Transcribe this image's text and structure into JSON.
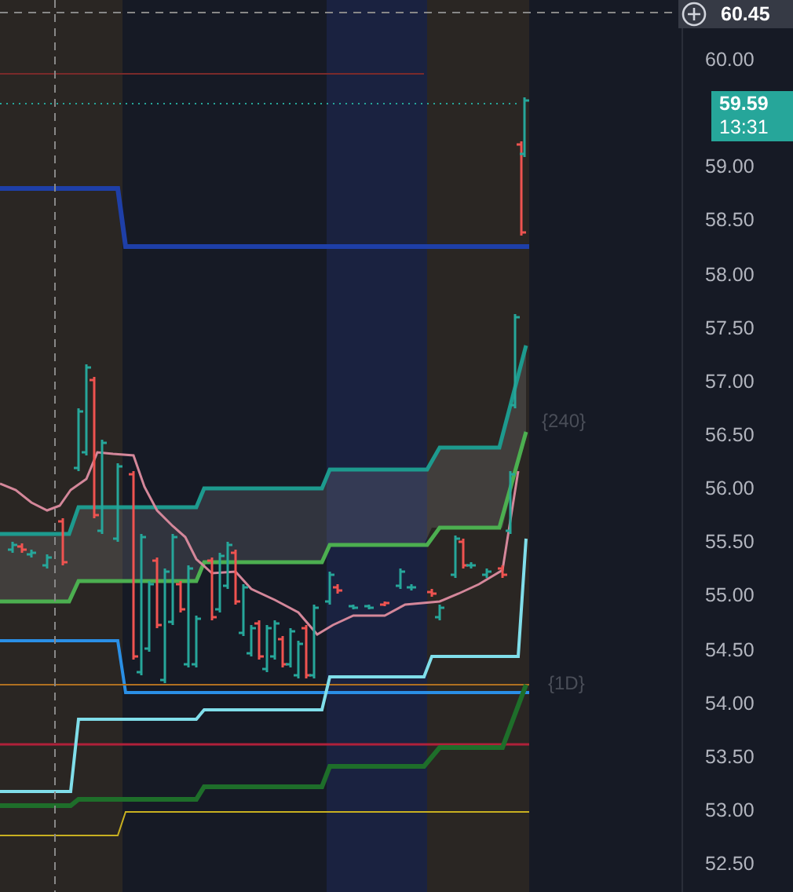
{
  "crosshair": {
    "price": "60.45"
  },
  "last_price": {
    "price": "59.59",
    "countdown": "13:31"
  },
  "price_axis": [
    "60.00",
    "59.00",
    "58.50",
    "58.00",
    "57.50",
    "57.00",
    "56.50",
    "56.00",
    "55.50",
    "55.00",
    "54.50",
    "54.00",
    "53.50",
    "53.00",
    "52.50"
  ],
  "level_labels": [
    {
      "text": "{240}"
    },
    {
      "text": "{1D}"
    }
  ]
}
